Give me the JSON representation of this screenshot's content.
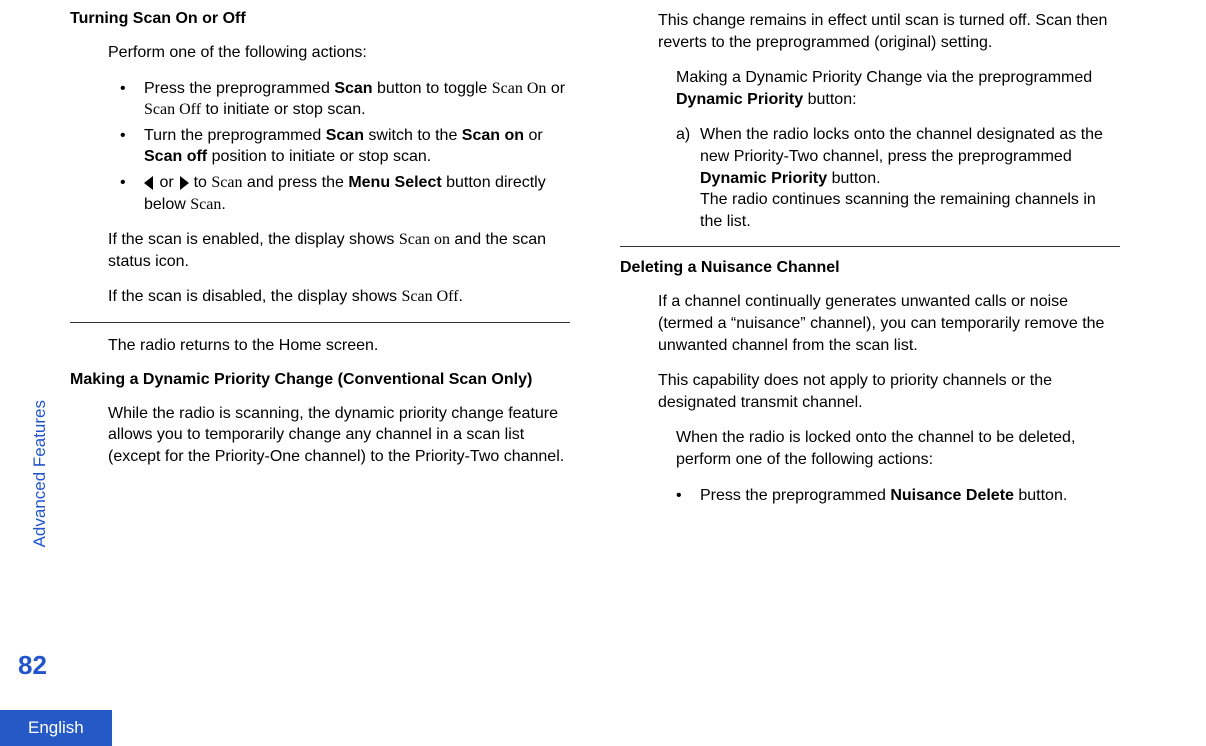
{
  "sideLabel": "Advanced Features",
  "pageNumber": "82",
  "langTab": "English",
  "left": {
    "heading1": "Turning Scan On or Off",
    "intro1": "Perform one of the following actions:",
    "bullet1_pre": "Press the preprogrammed ",
    "bullet1_scan": "Scan",
    "bullet1_mid": " button to toggle ",
    "bullet1_scanon": "Scan On",
    "bullet1_or": " or ",
    "bullet1_scanoff": "Scan Off",
    "bullet1_post": " to initiate or stop scan.",
    "bullet2_pre": "Turn the preprogrammed ",
    "bullet2_scan": "Scan",
    "bullet2_mid": " switch to the ",
    "bullet2_scanon": "Scan on",
    "bullet2_or": " or ",
    "bullet2_scanoff": "Scan off",
    "bullet2_post": " position to initiate or stop scan.",
    "bullet3_or": " or ",
    "bullet3_to": " to ",
    "bullet3_scan": "Scan",
    "bullet3_mid": " and press the ",
    "bullet3_menu": "Menu Select",
    "bullet3_mid2": " button directly below ",
    "bullet3_scan2": "Scan",
    "bullet3_post": ".",
    "enabled_pre": "If the scan is enabled, the display shows ",
    "enabled_scanon": "Scan on",
    "enabled_post": " and the scan status icon.",
    "disabled_pre": "If the scan is disabled, the display shows ",
    "disabled_scanoff": "Scan Off",
    "disabled_post": ".",
    "returnHome": "The radio returns to the Home screen.",
    "heading2": "Making a Dynamic Priority Change (Conventional Scan Only)",
    "dynPriorityBody": "While the radio is scanning, the dynamic priority change feature allows you to temporarily change any channel in a scan list (except for the Priority-One channel) to the Priority-Two channel."
  },
  "right": {
    "remainEffect": "This change remains in effect until scan is turned off. Scan then reverts to the preprogrammed (original) setting.",
    "dynPriorityVia_pre": "Making a Dynamic Priority Change via the preprogrammed ",
    "dynPriorityVia_bold": "Dynamic Priority",
    "dynPriorityVia_post": " button:",
    "stepA_pre": "When the radio locks onto the channel designated as the new Priority-Two channel, press the preprogrammed ",
    "stepA_bold": "Dynamic Priority",
    "stepA_post": " button.",
    "stepA_line2": "The radio continues scanning the remaining channels in the list.",
    "heading3": "Deleting a Nuisance Channel",
    "nuisanceBody1": "If a channel continually generates unwanted calls or noise (termed a “nuisance” channel), you can temporarily remove the unwanted channel from the scan list.",
    "nuisanceBody2": "This capability does not apply to priority channels or the designated transmit channel.",
    "nuisanceBody3": "When the radio is locked onto the channel to be deleted, perform one of the following actions:",
    "bullet4_pre": "Press the preprogrammed ",
    "bullet4_bold": "Nuisance Delete",
    "bullet4_post": " button.",
    "bulletDot": "•",
    "letterA": "a)"
  }
}
